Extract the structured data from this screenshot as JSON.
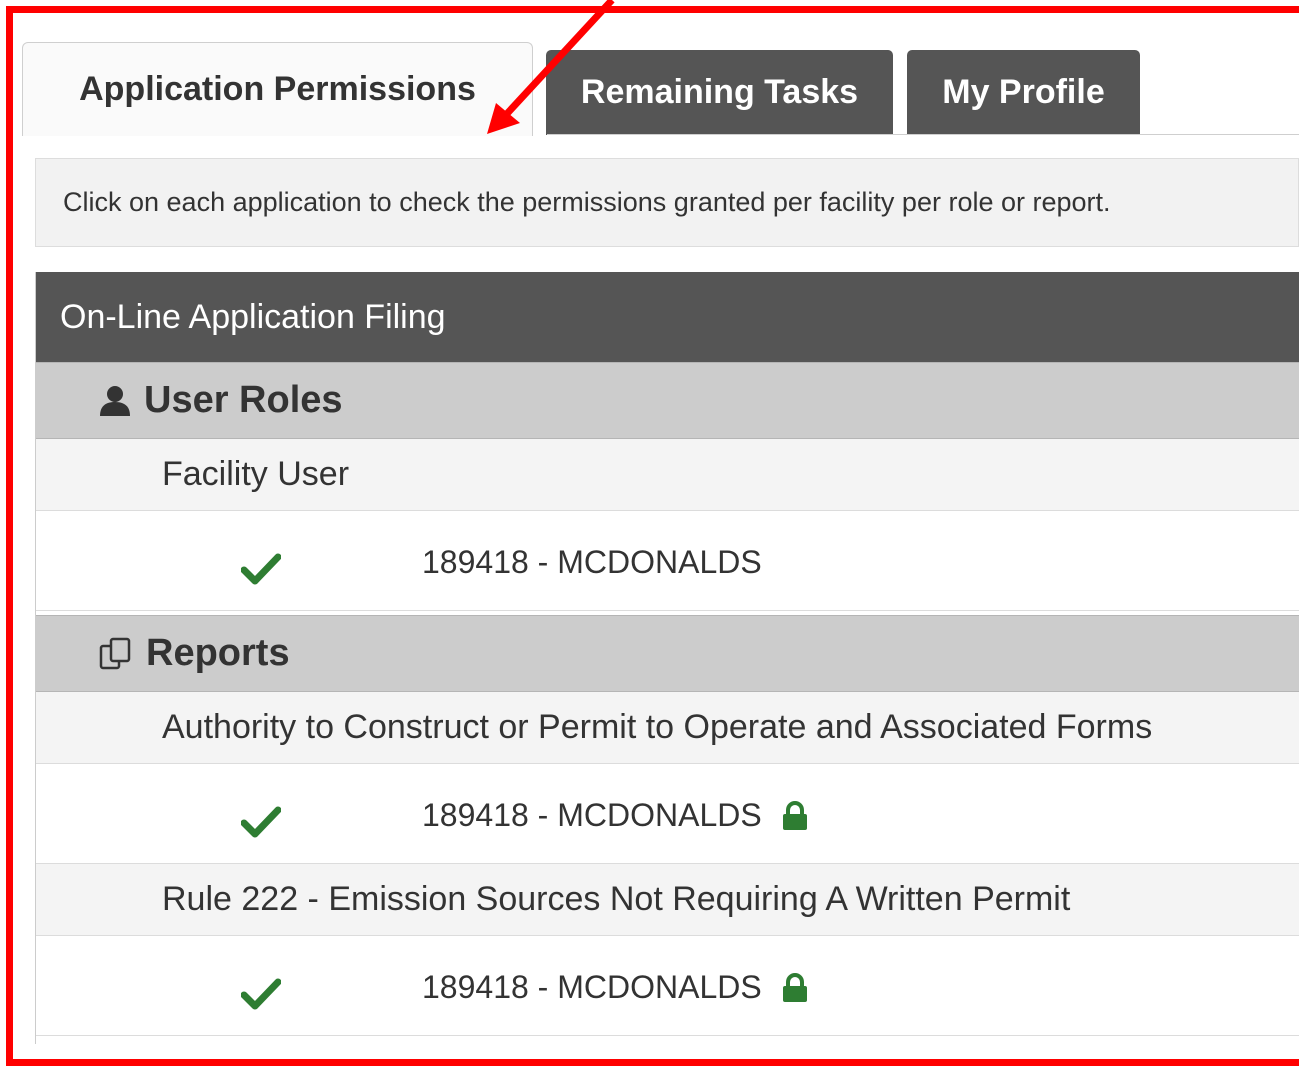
{
  "tabs": [
    {
      "label": "Application Permissions",
      "active": true
    },
    {
      "label": "Remaining Tasks",
      "active": false
    },
    {
      "label": "My Profile",
      "active": false
    }
  ],
  "info_text": "Click on each application to check the permissions granted per facility per role or report.",
  "application": {
    "title": "On-Line Application Filing",
    "user_roles": {
      "heading": "User Roles",
      "icon": "user-icon",
      "roles": [
        {
          "name": "Facility User",
          "facilities": [
            {
              "label": "189418 - MCDONALDS",
              "granted": true,
              "locked": false
            }
          ]
        }
      ]
    },
    "reports": {
      "heading": "Reports",
      "icon": "copy-icon",
      "items": [
        {
          "name": "Authority to Construct or Permit to Operate and Associated Forms",
          "facilities": [
            {
              "label": "189418 - MCDONALDS",
              "granted": true,
              "locked": true
            }
          ]
        },
        {
          "name": "Rule 222 - Emission Sources Not Requiring A Written Permit",
          "facilities": [
            {
              "label": "189418 - MCDONALDS",
              "granted": true,
              "locked": true
            }
          ]
        }
      ]
    }
  },
  "colors": {
    "annotation": "#ff0000",
    "check": "#2e7d32",
    "lock": "#2e7d32",
    "dark_header": "#555555"
  }
}
